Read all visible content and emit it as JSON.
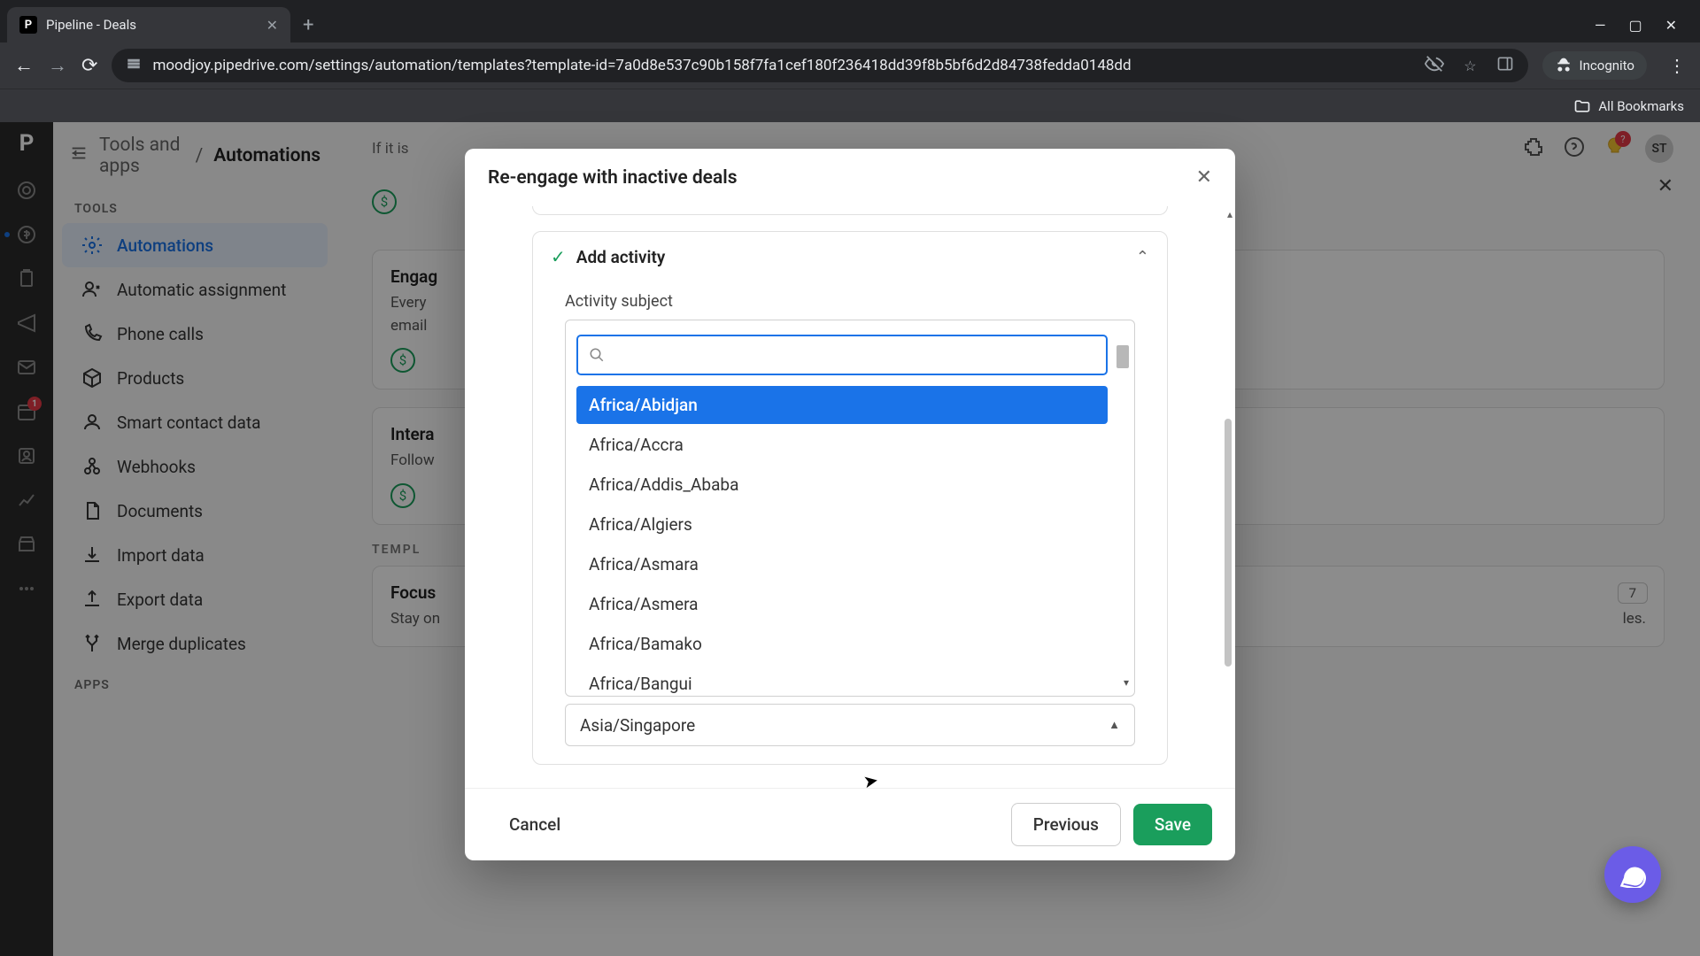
{
  "browser": {
    "tab_title": "Pipeline - Deals",
    "tab_favicon": "P",
    "url": "moodjoy.pipedrive.com/settings/automation/templates?template-id=7a0d8e537c90b158f7fa1cef180f236418dd39f8b5bf6d2d84738fedda0148dd",
    "incognito_label": "Incognito",
    "bookmarks_label": "All Bookmarks"
  },
  "rail": {
    "badge_1": "1"
  },
  "breadcrumb": {
    "parent": "Tools and apps",
    "current": "Automations"
  },
  "sidebar": {
    "section_tools": "TOOLS",
    "section_apps": "APPS",
    "items": [
      {
        "label": "Automations"
      },
      {
        "label": "Automatic assignment"
      },
      {
        "label": "Phone calls"
      },
      {
        "label": "Products"
      },
      {
        "label": "Smart contact data"
      },
      {
        "label": "Webhooks"
      },
      {
        "label": "Documents"
      },
      {
        "label": "Import data"
      },
      {
        "label": "Export data"
      },
      {
        "label": "Merge duplicates"
      }
    ]
  },
  "topbar": {
    "bulb_badge": "?",
    "avatar": "ST"
  },
  "bg": {
    "snippet_ifitis": "If it is",
    "card1_title": "Engag",
    "card1_body": "Every\nemail",
    "card2_title": "Intera",
    "card2_body": "Follow",
    "section_label": "TEMPL",
    "card3_title": "Focus",
    "card3_body": "Stay on",
    "card3_count": "7",
    "afterword": "les."
  },
  "modal": {
    "title": "Re-engage with inactive deals",
    "step_title": "Add activity",
    "field_label": "Activity subject",
    "options": [
      "Africa/Abidjan",
      "Africa/Accra",
      "Africa/Addis_Ababa",
      "Africa/Algiers",
      "Africa/Asmara",
      "Africa/Asmera",
      "Africa/Bamako",
      "Africa/Bangui"
    ],
    "selected_value": "Asia/Singapore",
    "footer": {
      "cancel": "Cancel",
      "previous": "Previous",
      "save": "Save"
    }
  }
}
